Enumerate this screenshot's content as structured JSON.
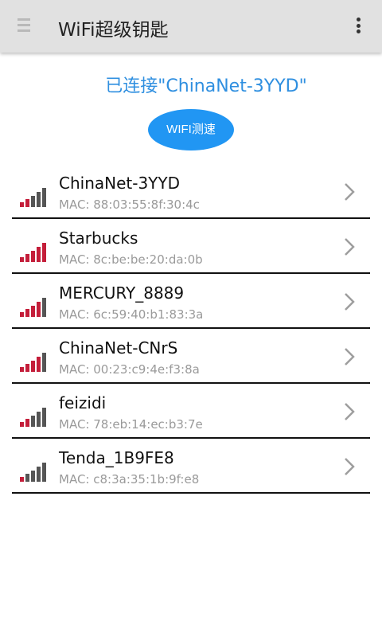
{
  "header": {
    "title": "WiFi超级钥匙",
    "menu_icon": "menu-icon",
    "overflow_icon": "more-vertical-icon"
  },
  "status": {
    "connected_text": "已连接\"ChinaNet-3YYD\""
  },
  "speed_button": {
    "label": "WIFI测速"
  },
  "colors": {
    "header_bg": "#e1e1e1",
    "accent_blue": "#2196f3",
    "status_blue": "#2f8fe0",
    "signal_red": "#c41e3a",
    "signal_gray": "#555555"
  },
  "networks": [
    {
      "ssid": "ChinaNet-3YYD",
      "mac": "MAC: 88:03:55:8f:30:4c",
      "signal_bars": 2
    },
    {
      "ssid": "Starbucks",
      "mac": "MAC: 8c:be:be:20:da:0b",
      "signal_bars": 5
    },
    {
      "ssid": "MERCURY_8889",
      "mac": "MAC: 6c:59:40:b1:83:3a",
      "signal_bars": 4
    },
    {
      "ssid": "ChinaNet-CNrS",
      "mac": "MAC: 00:23:c9:4e:f3:8a",
      "signal_bars": 4
    },
    {
      "ssid": "feizidi",
      "mac": "MAC: 78:eb:14:ec:b3:7e",
      "signal_bars": 2
    },
    {
      "ssid": "Tenda_1B9FE8",
      "mac": "MAC: c8:3a:35:1b:9f:e8",
      "signal_bars": 1
    }
  ]
}
